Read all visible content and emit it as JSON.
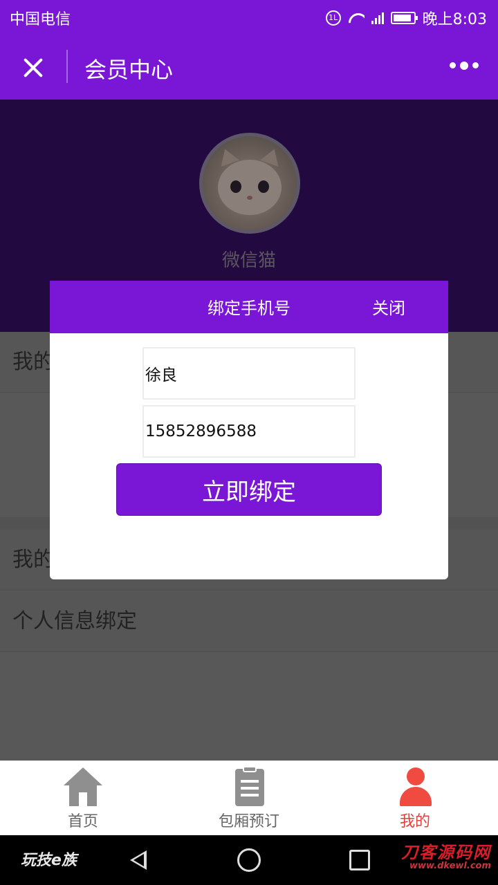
{
  "status_bar": {
    "carrier": "中国电信",
    "network_badge": "1L",
    "network_type": "4G 2G",
    "time": "晚上8:03",
    "battery_level": 0.9
  },
  "nav": {
    "title": "会员中心",
    "close_icon": "close-icon",
    "more_icon": "more-dots-icon"
  },
  "profile": {
    "avatar": "cat-avatar",
    "name": "微信猫"
  },
  "list": {
    "items": [
      {
        "label": "我的"
      },
      {
        "label": "我的"
      },
      {
        "label": "个人信息绑定"
      }
    ]
  },
  "modal": {
    "title": "绑定手机号",
    "close_label": "关闭",
    "name_value": "徐良",
    "phone_value": "15852896588",
    "submit_label": "立即绑定"
  },
  "tabbar": {
    "tabs": [
      {
        "label": "首页",
        "icon": "home-icon",
        "active": false
      },
      {
        "label": "包厢预订",
        "icon": "clipboard-icon",
        "active": false
      },
      {
        "label": "我的",
        "icon": "user-icon",
        "active": true
      }
    ]
  },
  "system_nav": {
    "watermark_left": "玩技e族",
    "watermark_right_main": "刀客源码网",
    "watermark_right_sub": "www.dkewl.com"
  },
  "colors": {
    "accent": "#7a16d6",
    "active_tab": "#e2413a",
    "header_bg": "#220a40",
    "overlay_bg": "#585858"
  }
}
